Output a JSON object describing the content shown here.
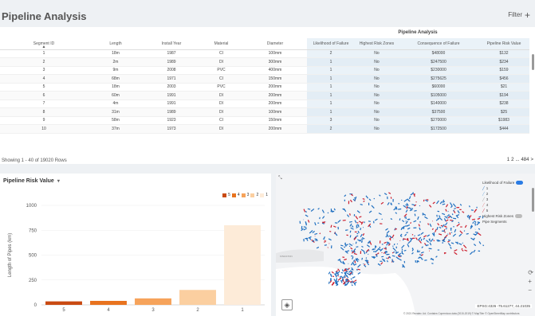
{
  "header": {
    "title": "Pipeline Analysis",
    "filter_label": "Filter"
  },
  "table": {
    "group_label": "Pipeline Analysis",
    "columns": [
      "Segment ID",
      "Length",
      "Install Year",
      "Material",
      "Diameter",
      "Likelihood of Failure",
      "Highest Risk Zones",
      "Consequence of Failure",
      "Pipeline Risk Value"
    ],
    "rows": [
      [
        "1",
        "18m",
        "1987",
        "CI",
        "100mm",
        "2",
        "No",
        "$48000",
        "$132"
      ],
      [
        "2",
        "2m",
        "1989",
        "DI",
        "300mm",
        "1",
        "No",
        "$247500",
        "$234"
      ],
      [
        "3",
        "9m",
        "2008",
        "PVC",
        "400mm",
        "1",
        "No",
        "$230000",
        "$159"
      ],
      [
        "4",
        "68m",
        "1971",
        "CI",
        "150mm",
        "1",
        "No",
        "$275625",
        "$456"
      ],
      [
        "5",
        "18m",
        "2003",
        "PVC",
        "200mm",
        "1",
        "No",
        "$60000",
        "$21"
      ],
      [
        "6",
        "60m",
        "1991",
        "DI",
        "200mm",
        "1",
        "No",
        "$105000",
        "$194"
      ],
      [
        "7",
        "4m",
        "1991",
        "DI",
        "200mm",
        "1",
        "No",
        "$140000",
        "$238"
      ],
      [
        "8",
        "31m",
        "1989",
        "DI",
        "100mm",
        "1",
        "No",
        "$37500",
        "$25"
      ],
      [
        "9",
        "58m",
        "1923",
        "CI",
        "150mm",
        "3",
        "No",
        "$270000",
        "$1983"
      ],
      [
        "10",
        "37m",
        "1973",
        "DI",
        "200mm",
        "2",
        "No",
        "$172500",
        "$444"
      ]
    ],
    "showing_text": "Showing 1 - 40 of 19020 Rows",
    "pager": [
      "1",
      "2",
      "...",
      "484",
      ">"
    ]
  },
  "chart_panel": {
    "title": "Pipeline Risk Value",
    "caret": "▾"
  },
  "chart_data": {
    "type": "bar",
    "categories": [
      "5",
      "4",
      "3",
      "2",
      "1"
    ],
    "values": [
      35,
      40,
      65,
      150,
      800
    ],
    "colors": [
      "#c94a12",
      "#e8731f",
      "#f6a35b",
      "#fbcfa0",
      "#fdebd8"
    ],
    "ylabel": "Length of Pipes (km)",
    "yticks": [
      0,
      250,
      500,
      750,
      1000
    ],
    "ylim": [
      0,
      1000
    ],
    "legend": [
      "5",
      "4",
      "3",
      "2",
      "1"
    ]
  },
  "map": {
    "layer_title": "Likelihood of Failure",
    "levels": [
      "1",
      "2",
      "3",
      "4",
      "5"
    ],
    "level_colors": [
      "#1f6fc0",
      "#6aa7dd",
      "#9c9c9c",
      "#e37a7a",
      "#cc1f2f"
    ],
    "risk_zones_label": "Highest Risk Zones",
    "risk_zones_sub": "Pipe Segments",
    "coords": "EPSG:4326 -75.61277, 44.21035",
    "attribution": "© 2021 Rezatec Ltd. Contains Copernicus data (2015-2019) © MapTiler © OpenStreetMap contributors",
    "place_label": "KINGSTON"
  }
}
